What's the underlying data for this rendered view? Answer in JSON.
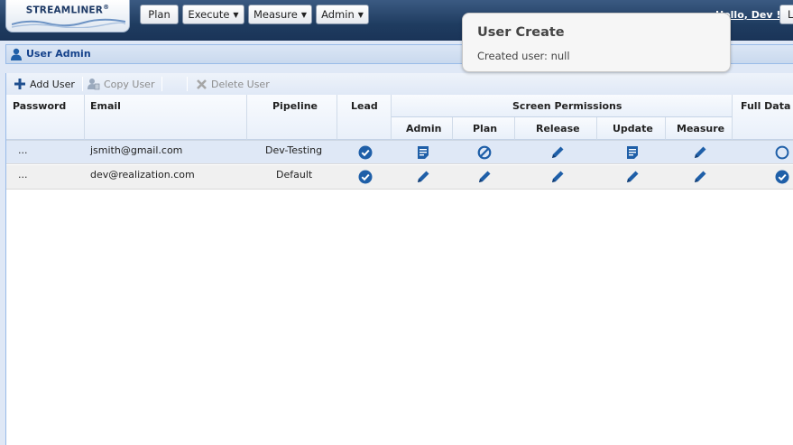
{
  "app": {
    "logo": "STREAMLINER",
    "logo_mark": "®"
  },
  "nav": {
    "plan": "Plan",
    "execute": "Execute",
    "measure": "Measure",
    "admin": "Admin",
    "greeting": "Hello, Dev !",
    "logout_partial": "L"
  },
  "panel": {
    "title": "User Admin"
  },
  "toolbar": {
    "add_user": "Add User",
    "copy_user": "Copy User",
    "delete_user": "Delete User"
  },
  "grid": {
    "columns": {
      "password": "Password",
      "email": "Email",
      "pipeline": "Pipeline",
      "lead": "Lead",
      "screen_permissions": "Screen Permissions",
      "admin": "Admin",
      "plan": "Plan",
      "release": "Release",
      "update": "Update",
      "measure": "Measure",
      "full_data_access": "Full Data A"
    },
    "rows": [
      {
        "password": "...",
        "email": "jsmith@gmail.com",
        "pipeline": "Dev-Testing",
        "lead": "check-circle-icon",
        "admin": "document-icon",
        "plan": "no-access-icon",
        "release": "pencil-icon",
        "update": "document-icon",
        "measure": "pencil-icon",
        "full_data": "empty-circle-icon"
      },
      {
        "password": "...",
        "email": "dev@realization.com",
        "pipeline": "Default",
        "lead": "check-circle-icon",
        "admin": "pencil-icon",
        "plan": "pencil-icon",
        "release": "pencil-icon",
        "update": "pencil-icon",
        "measure": "pencil-icon",
        "full_data": "check-circle-icon"
      }
    ]
  },
  "toast": {
    "title": "User Create",
    "message": "Created user: null"
  },
  "colors": {
    "accent": "#15428b",
    "icon_blue": "#1f5fa8",
    "topbar": "#1f3c60"
  }
}
